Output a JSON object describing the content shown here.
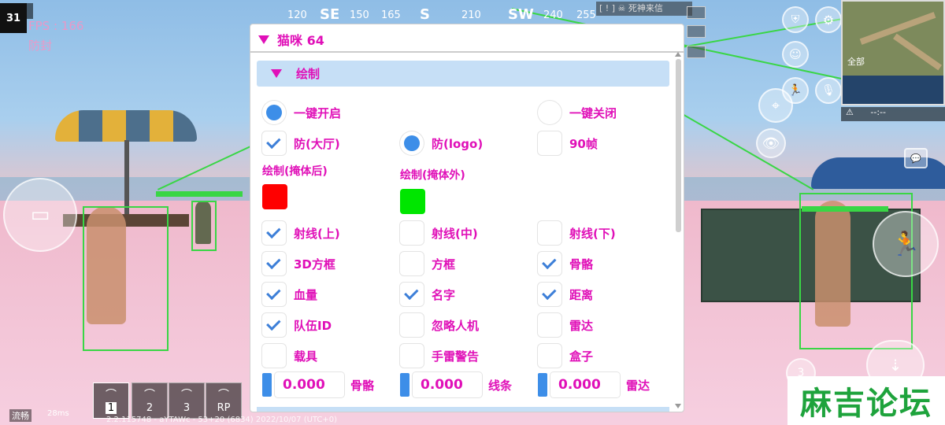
{
  "hud": {
    "player_count_label": "人数",
    "player_count": "31",
    "fps": "FPS : 166",
    "fangfeng": "防封",
    "compass": [
      "120",
      "SE",
      "150",
      "165",
      "S",
      "210",
      "SW",
      "240",
      "255"
    ],
    "top_message": "[ ! ] ☠ 死神来信"
  },
  "minimap": {
    "all_label": "全部",
    "warn_text": "--:--"
  },
  "quickslots": [
    "1",
    "2",
    "3",
    "RP"
  ],
  "status": {
    "smooth": "流畅",
    "ping": "28ms",
    "build_info": "2.2.115748 - aYTAWc - 53+20 (6834) 2022/10/07 (UTC+0)"
  },
  "watermark": "麻吉论坛",
  "menu": {
    "title": "猫咪 64",
    "section": "绘制",
    "row1": {
      "left": "一键开启",
      "right": "一键关闭"
    },
    "row2": [
      "防(大厅)",
      "防(logo)",
      "90帧"
    ],
    "color_label_left": "绘制(掩体后)",
    "color_label_right": "绘制(掩体外)",
    "colors": {
      "behind_cover": "#ff0000",
      "outside_cover": "#00e600",
      "accent": "#e010b8",
      "check": "#3d7fd8"
    },
    "rows": [
      [
        "射线(上)",
        "射线(中)",
        "射线(下)"
      ],
      [
        "3D方框",
        "方框",
        "骨骼"
      ],
      [
        "血量",
        "名字",
        "距离"
      ],
      [
        "队伍ID",
        "忽略人机",
        "雷达"
      ],
      [
        "载具",
        "手雷警告",
        "盒子"
      ]
    ],
    "checked": [
      [
        true,
        false,
        false
      ],
      [
        true,
        false,
        true
      ],
      [
        true,
        true,
        true
      ],
      [
        true,
        false,
        false
      ],
      [
        false,
        false,
        false
      ]
    ],
    "numbers": [
      {
        "value": "0.000",
        "label": "骨骼"
      },
      {
        "value": "0.000",
        "label": "线条"
      },
      {
        "value": "0.000",
        "label": "雷达"
      }
    ]
  }
}
